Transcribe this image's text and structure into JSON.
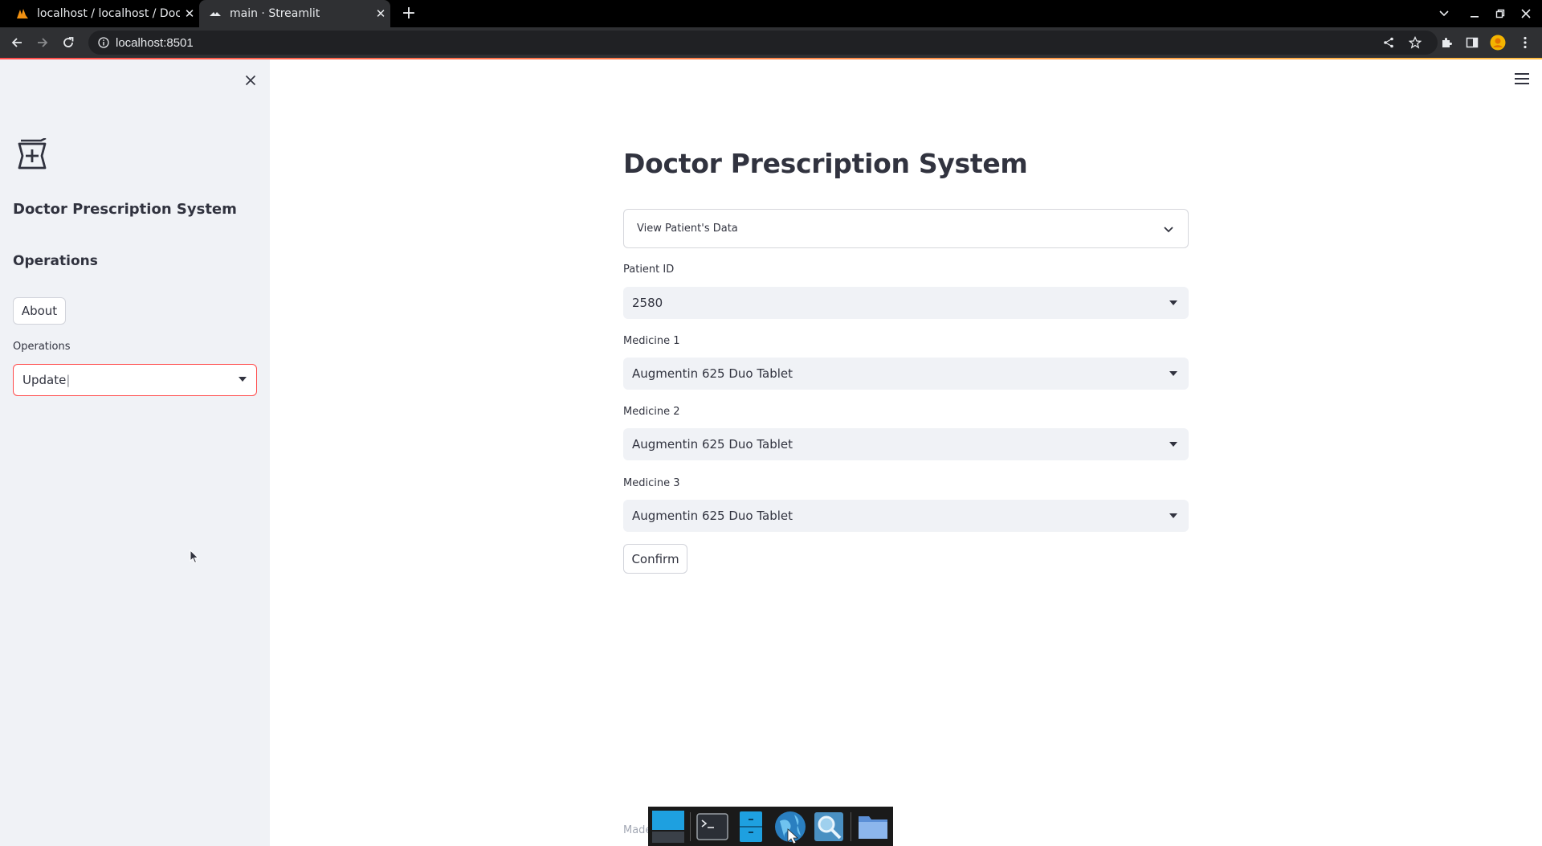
{
  "browser": {
    "tabs": [
      {
        "title": "localhost / localhost / Doct",
        "active": false
      },
      {
        "title": "main · Streamlit",
        "active": true
      }
    ],
    "url": "localhost:8501"
  },
  "sidebar": {
    "title": "Doctor Prescription System",
    "heading": "Operations",
    "about_label": "About",
    "operations_label": "Operations",
    "operations_value": "Update"
  },
  "main": {
    "title": "Doctor Prescription System",
    "expander_label": "View Patient's Data",
    "fields": [
      {
        "label": "Patient ID",
        "value": "2580"
      },
      {
        "label": "Medicine 1",
        "value": "Augmentin 625 Duo Tablet"
      },
      {
        "label": "Medicine 2",
        "value": "Augmentin 625 Duo Tablet"
      },
      {
        "label": "Medicine 3",
        "value": "Augmentin 625 Duo Tablet"
      }
    ],
    "confirm_label": "Confirm",
    "footer": "Made"
  },
  "colors": {
    "accent": "#ff4b4b",
    "sidebar_bg": "#f0f2f6",
    "text": "#31333f"
  },
  "dock": [
    "desktop-icon",
    "terminal-icon",
    "file-manager-icon",
    "browser-icon",
    "search-icon",
    "folder-icon"
  ]
}
